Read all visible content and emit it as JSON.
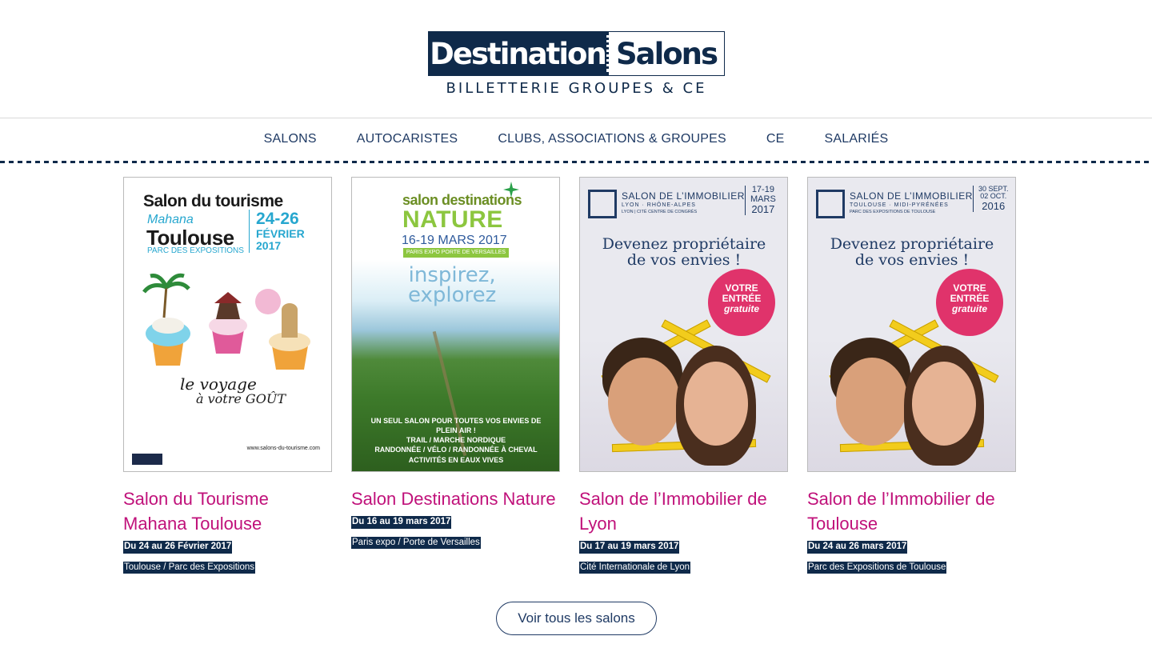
{
  "brand": {
    "name_left": "Destination",
    "name_right": "Salons",
    "tagline": "BILLETTERIE GROUPES & CE",
    "color_navy": "#0f2a4a",
    "color_pink": "#c0117a"
  },
  "nav": {
    "items": [
      {
        "label": "SALONS"
      },
      {
        "label": "AUTOCARISTES"
      },
      {
        "label": "CLUBS, ASSOCIATIONS & GROUPES"
      },
      {
        "label": "CE"
      },
      {
        "label": "SALARIÉS"
      }
    ]
  },
  "cards": [
    {
      "title": "Salon du Tourisme Mahana Toulouse",
      "date": "Du 24 au 26 Février 2017",
      "place": "Toulouse / Parc des Expositions",
      "poster": {
        "line1": "Salon du tourisme",
        "line2": "Mahana",
        "line3": "Toulouse",
        "line4": "PARC DES EXPOSITIONS",
        "date_days": "24-26",
        "date_month": "FÉVRIER",
        "date_year": "2017",
        "slogan1": "le voyage",
        "slogan2": "à votre GOÛT",
        "url": "www.salons-du-tourisme.com"
      }
    },
    {
      "title": "Salon Destinations Nature",
      "date": "Du 16 au 19 mars 2017",
      "place": "Paris expo / Porte de Versailles",
      "poster": {
        "line1": "salon destinations",
        "line2": "NATURE",
        "line3": "16-19 MARS 2017",
        "line4": "PARIS EXPO PORTE DE VERSAILLES",
        "slogan1": "inspirez,",
        "slogan2": "explorez",
        "bottom1": "UN SEUL SALON POUR TOUTES VOS ENVIES DE PLEIN AIR !",
        "bottom2": "TRAIL / MARCHE NORDIQUE",
        "bottom3": "RANDONNÉE / VÉLO / RANDONNÉE À CHEVAL",
        "bottom4": "ACTIVITÉS EN EAUX VIVES"
      }
    },
    {
      "title": "Salon de l’Immobilier de Lyon",
      "date": "Du 17 au 19 mars 2017",
      "place": "Cité Internationale de Lyon",
      "poster": {
        "line1": "SALON DE L’IMMOBILIER",
        "line2": "LYON · RHÔNE-ALPES",
        "line3": "LYON | CITÉ CENTRE DE CONGRÈS",
        "date1": "17-19",
        "date2": "MARS",
        "date3": "2017",
        "slogan1": "Devenez propriétaire",
        "slogan2": "de vos envies !",
        "circle1": "VOTRE",
        "circle2": "ENTRÉE",
        "circle3": "gratuite"
      }
    },
    {
      "title": "Salon de l’Immobilier de Toulouse",
      "date": "Du 24 au 26 mars 2017",
      "place": "Parc des Expositions de Toulouse",
      "poster": {
        "line1": "SALON DE L’IMMOBILIER",
        "line2": "TOULOUSE · MIDI-PYRÉNÉES",
        "line3": "PARC DES EXPOSITIONS DE TOULOUSE",
        "date1": "30 SEPT.",
        "date2": "02 OCT.",
        "date3": "2016",
        "slogan1": "Devenez propriétaire",
        "slogan2": "de vos envies !",
        "circle1": "VOTRE",
        "circle2": "ENTRÉE",
        "circle3": "gratuite"
      }
    }
  ],
  "cta": {
    "label": "Voir tous les salons"
  }
}
